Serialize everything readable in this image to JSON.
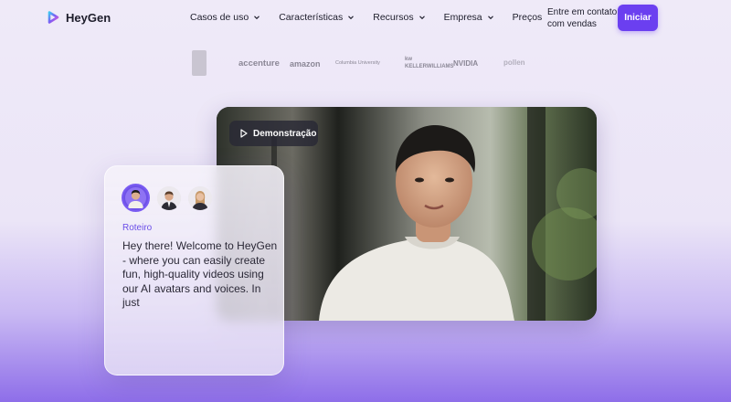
{
  "brand": {
    "name": "HeyGen"
  },
  "nav": {
    "items": [
      {
        "label": "Casos de uso",
        "has_dropdown": true
      },
      {
        "label": "Características",
        "has_dropdown": true
      },
      {
        "label": "Recursos",
        "has_dropdown": true
      },
      {
        "label": "Empresa",
        "has_dropdown": true
      },
      {
        "label": "Preços",
        "has_dropdown": false
      }
    ],
    "contact_label": "Entre em contato com vendas",
    "cta_label": "Iniciar"
  },
  "logos": {
    "items": [
      {
        "label": "accenture"
      },
      {
        "label": "amazon"
      },
      {
        "label": "Columbia University"
      },
      {
        "label": "kw KELLERWILLIAMS"
      },
      {
        "label": "NVIDIA"
      },
      {
        "label": "pollen"
      }
    ]
  },
  "video": {
    "demo_label": "Demonstração"
  },
  "script_card": {
    "label": "Roteiro",
    "text": "Hey there! Welcome to HeyGen - where you can easily create fun, high-quality videos using our AI avatars and voices. In just"
  },
  "colors": {
    "accent": "#6b3ff0",
    "label_purple": "#6a4ee8",
    "text_dark": "#1d1d2b"
  }
}
